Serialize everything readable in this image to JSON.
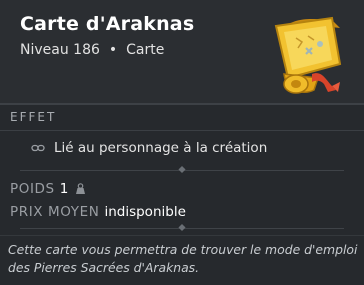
{
  "item": {
    "name": "Carte d'Araknas",
    "level_text": "Niveau 186",
    "separator": "•",
    "type": "Carte",
    "image_icon": "treasure-map-icon"
  },
  "effects": {
    "heading": "EFFET",
    "items": [
      {
        "icon": "link-icon",
        "text": "Lié au personnage à la création"
      }
    ]
  },
  "stats": {
    "weight_label": "POIDS",
    "weight_value": "1",
    "weight_icon": "weight-icon",
    "price_label": "PRIX MOYEN",
    "price_value": "indisponible"
  },
  "description": "Cette carte vous permettra de trouver le mode d'emploi des Pierres Sacrées d'Araknas.",
  "colors": {
    "background": "#26292d",
    "header": "#2b2e32",
    "map_yellow": "#f2c230",
    "ribbon_red": "#d8442a"
  }
}
